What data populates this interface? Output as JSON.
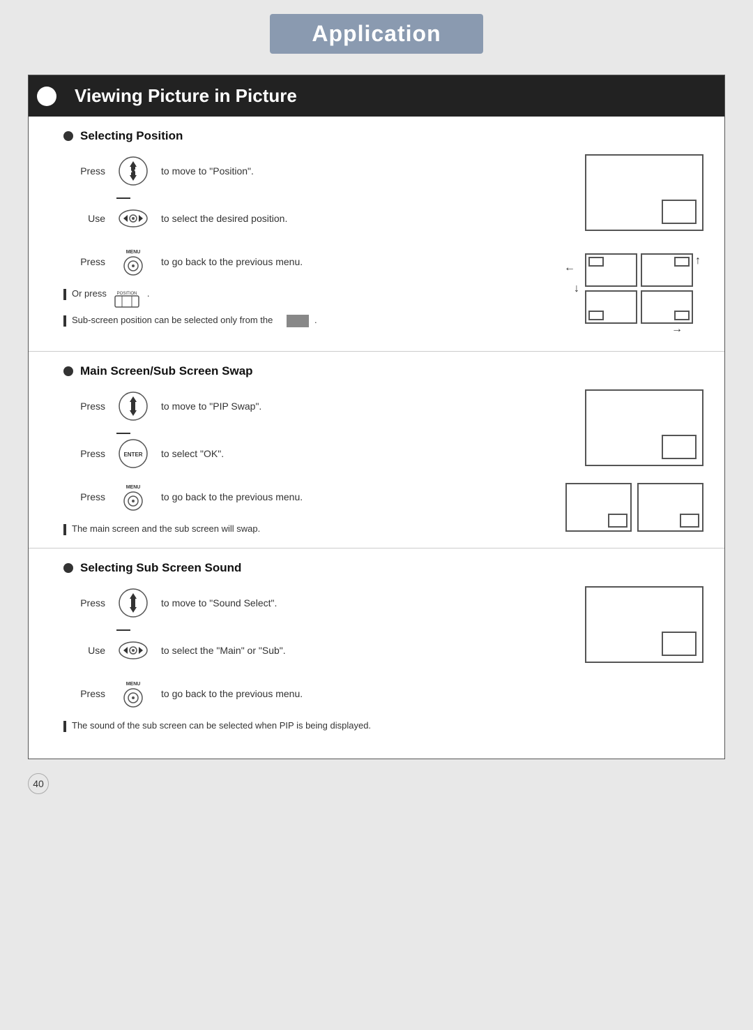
{
  "page": {
    "title": "Application",
    "page_number": "40"
  },
  "section": {
    "heading": "Viewing Picture in Picture",
    "subsections": [
      {
        "id": "selecting-position",
        "title": "Selecting Position",
        "instructions": [
          {
            "label": "Press",
            "button": "up-down",
            "text": "to move to \"Position\"."
          },
          {
            "label": "Use",
            "button": "left-right",
            "text": "to select the desired position."
          },
          {
            "label": "Press",
            "button": "menu",
            "text": "to go back to the previous menu."
          }
        ],
        "or_press": "Or press",
        "note1": "Sub-screen position can be selected only from the",
        "note1_suffix": "."
      },
      {
        "id": "main-sub-swap",
        "title": "Main Screen/Sub Screen Swap",
        "instructions": [
          {
            "label": "Press",
            "button": "up-down",
            "text": "to move to \"PIP Swap\"."
          },
          {
            "label": "Press",
            "button": "enter",
            "text": "to select \"OK\"."
          },
          {
            "label": "Press",
            "button": "menu",
            "text": "to go back to the previous menu."
          }
        ],
        "note1": "The main screen and the sub screen will swap."
      },
      {
        "id": "selecting-sub-screen-sound",
        "title": "Selecting Sub Screen Sound",
        "instructions": [
          {
            "label": "Press",
            "button": "up-down",
            "text": "to move to \"Sound Select\"."
          },
          {
            "label": "Use",
            "button": "left-right",
            "text": "to select the \"Main\" or \"Sub\"."
          },
          {
            "label": "Press",
            "button": "menu",
            "text": "to go back to the previous menu."
          }
        ],
        "note1": "The sound of the sub screen can be selected  when PIP is being displayed."
      }
    ]
  }
}
